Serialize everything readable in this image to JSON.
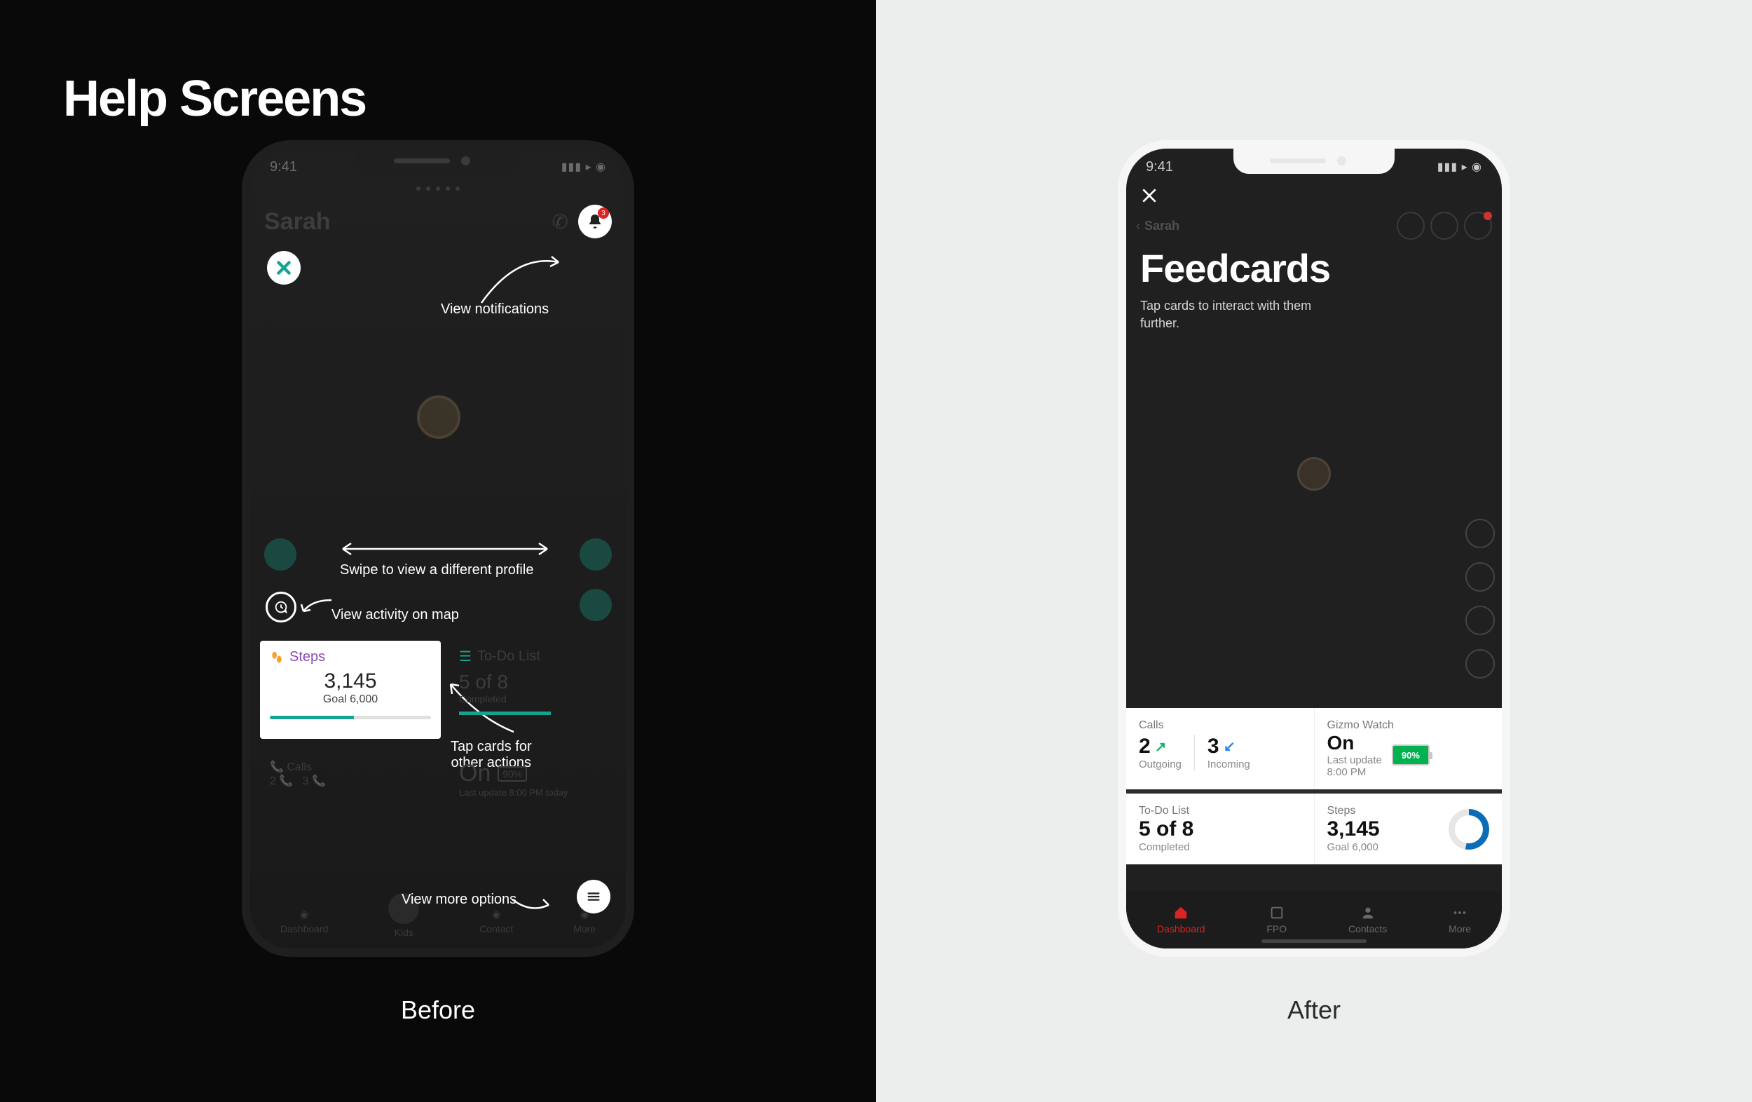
{
  "title": "Help Screens",
  "before": {
    "caption": "Before",
    "status_time": "9:41",
    "status_right": "📶 📡 ◉",
    "user_name": "Sarah",
    "notifications_badge": "3",
    "annotations": {
      "notifications": "View notifications",
      "swipe": "Swipe to view a different  profile",
      "activity": "View activity on map",
      "tap_cards": "Tap cards for\nother actions",
      "more": "View more options"
    },
    "steps_card": {
      "label": "Steps",
      "value": "3,145",
      "goal": "Goal 6,000"
    },
    "dim_todo": {
      "label": "To-Do List",
      "value": "5 of 8",
      "sub": "Completed"
    },
    "dim_calls": {
      "label": "Calls",
      "v1": "2",
      "v2": "3"
    },
    "dim_on": {
      "label": "On",
      "sub": "Last update 8:00 PM today",
      "batt": "90%"
    }
  },
  "after": {
    "caption": "After",
    "status_time": "9:41",
    "back_name": "Sarah",
    "title": "Feedcards",
    "subtitle": "Tap cards to interact with them further.",
    "calls": {
      "label": "Calls",
      "outgoing_count": "2",
      "outgoing_label": "Outgoing",
      "incoming_count": "3",
      "incoming_label": "Incoming"
    },
    "watch": {
      "label": "Gizmo Watch",
      "state": "On",
      "sub": "Last update\n8:00 PM",
      "battery": "90%"
    },
    "todo": {
      "label": "To-Do List",
      "value": "5 of 8",
      "sub": "Completed"
    },
    "steps": {
      "label": "Steps",
      "value": "3,145",
      "sub": "Goal 6,000"
    },
    "tabs": {
      "dashboard": "Dashboard",
      "fpo": "FPO",
      "contacts": "Contacts",
      "more": "More"
    }
  }
}
